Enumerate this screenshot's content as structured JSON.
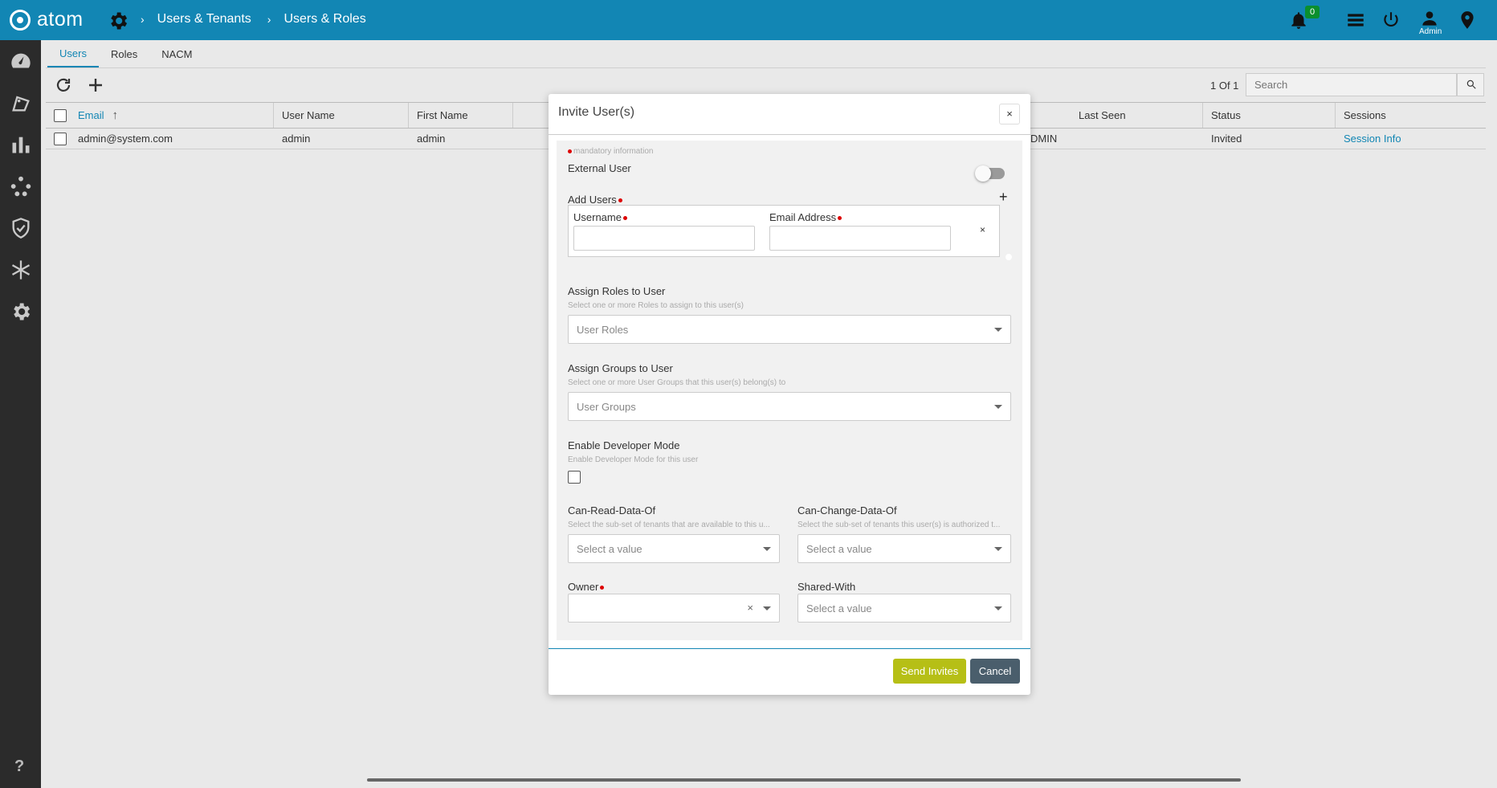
{
  "app": {
    "logo_text": "atom",
    "breadcrumbs": [
      "Users & Tenants",
      "Users & Roles"
    ],
    "notification_count": "0",
    "user_label": "Admin",
    "accent_color": "#1286b4"
  },
  "tabs": [
    "Users",
    "Roles",
    "NACM"
  ],
  "toolbar": {
    "pager": "1 Of 1",
    "search_placeholder": "Search"
  },
  "table": {
    "columns": [
      "Email",
      "User Name",
      "First Name",
      "Last Seen",
      "Status",
      "Sessions"
    ],
    "rows": [
      {
        "email": "admin@system.com",
        "username": "admin",
        "first_name": "admin",
        "hidden_fragment": "DMIN",
        "status": "Invited",
        "sessions": "Session Info"
      }
    ]
  },
  "modal": {
    "title": "Invite User(s)",
    "close": "×",
    "mandatory": "mandatory information",
    "external_user": "External User",
    "add_users": "Add Users",
    "add_plus": "+",
    "username_label": "Username",
    "email_label": "Email Address",
    "remove_x": "×",
    "roles": {
      "label": "Assign Roles to User",
      "help": "Select one or more Roles to assign to this user(s)",
      "placeholder": "User Roles"
    },
    "groups": {
      "label": "Assign Groups to User",
      "help": "Select one or more User Groups that this user(s) belong(s) to",
      "placeholder": "User Groups"
    },
    "devmode": {
      "label": "Enable Developer Mode",
      "help": "Enable Developer Mode for this user"
    },
    "can_read": {
      "label": "Can-Read-Data-Of",
      "help": "Select the sub-set of tenants that are available to this u...",
      "placeholder": "Select a value"
    },
    "can_change": {
      "label": "Can-Change-Data-Of",
      "help": "Select the sub-set of tenants this user(s) is authorized t...",
      "placeholder": "Select a value"
    },
    "owner": {
      "label": "Owner",
      "clear": "×"
    },
    "shared": {
      "label": "Shared-With",
      "placeholder": "Select a value"
    },
    "send_label": "Send Invites",
    "cancel_label": "Cancel"
  }
}
